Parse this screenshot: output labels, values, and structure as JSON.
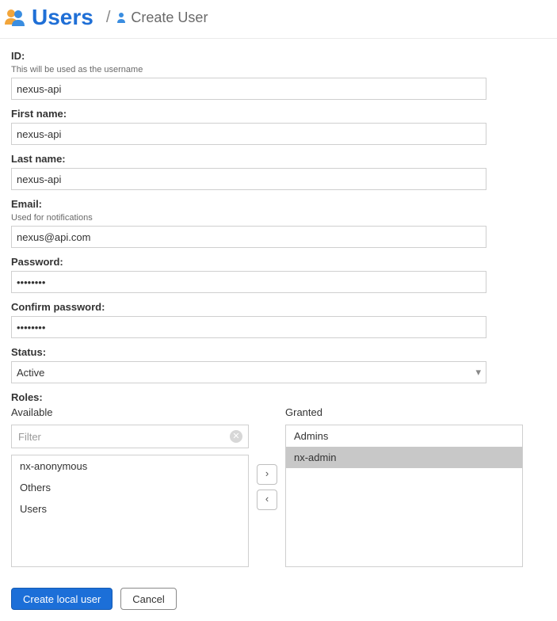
{
  "header": {
    "title": "Users",
    "separator": "/",
    "sub": "Create User"
  },
  "form": {
    "id": {
      "label": "ID:",
      "hint": "This will be used as the username",
      "value": "nexus-api"
    },
    "first_name": {
      "label": "First name:",
      "value": "nexus-api"
    },
    "last_name": {
      "label": "Last name:",
      "value": "nexus-api"
    },
    "email": {
      "label": "Email:",
      "hint": "Used for notifications",
      "value": "nexus@api.com"
    },
    "password": {
      "label": "Password:",
      "value": "••••••••"
    },
    "confirm_password": {
      "label": "Confirm password:",
      "value": "••••••••"
    },
    "status": {
      "label": "Status:",
      "value": "Active"
    },
    "roles": {
      "label": "Roles:",
      "available_title": "Available",
      "granted_title": "Granted",
      "filter_placeholder": "Filter",
      "available": [
        "nx-anonymous",
        "Others",
        "Users"
      ],
      "granted": [
        "Admins",
        "nx-admin"
      ],
      "granted_selected_index": 1,
      "move_right": "›",
      "move_left": "‹"
    }
  },
  "actions": {
    "create": "Create local user",
    "cancel": "Cancel"
  }
}
